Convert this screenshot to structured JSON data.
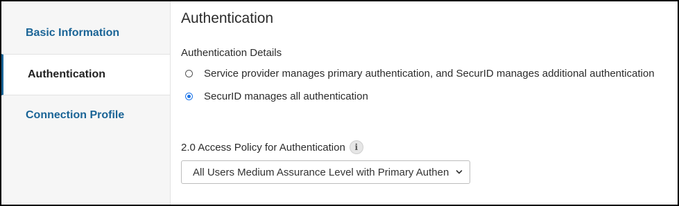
{
  "sidebar": {
    "items": [
      {
        "label": "Basic Information",
        "active": false
      },
      {
        "label": "Authentication",
        "active": true
      },
      {
        "label": "Connection Profile",
        "active": false
      }
    ]
  },
  "main": {
    "title": "Authentication",
    "details_label": "Authentication Details",
    "options": [
      {
        "label": "Service provider manages primary authentication, and SecurID manages additional authentication",
        "selected": false
      },
      {
        "label": "SecurID manages all authentication",
        "selected": true
      }
    ],
    "policy": {
      "label": "2.0 Access Policy for Authentication",
      "info_icon": "i",
      "selected_value": "All Users Medium Assurance Level with Primary Authentication"
    }
  },
  "colors": {
    "accent": "#1a6496",
    "radio_selected": "#1a73e8"
  },
  "icons": [
    "info-icon",
    "chevron-down-icon"
  ]
}
